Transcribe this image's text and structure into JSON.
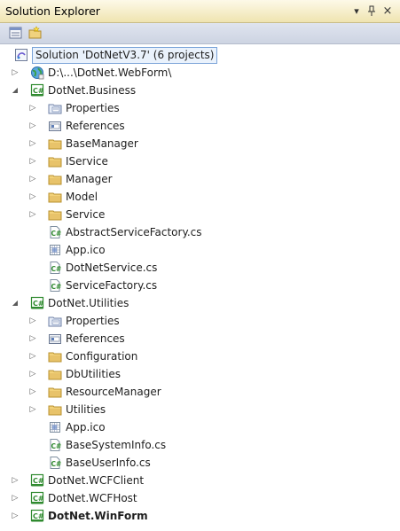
{
  "window": {
    "title": "Solution Explorer",
    "buttons": {
      "dropdown_glyph": "▾",
      "pin_glyph": "ᐩ",
      "close_glyph": "×"
    }
  },
  "toolbar": {
    "items": [
      {
        "name": "properties-icon"
      },
      {
        "name": "show-all-files-icon"
      }
    ]
  },
  "tree": {
    "rows": [
      {
        "id": "solution",
        "depth": 0,
        "expander": "",
        "icon": "solution-icon",
        "label": "Solution 'DotNetV3.7' (6 projects)",
        "selected": true,
        "bold": false
      },
      {
        "id": "webform-site",
        "depth": 1,
        "expander": "collapsed",
        "icon": "website-icon",
        "label": "D:\\...\\DotNet.WebForm\\",
        "bold": false
      },
      {
        "id": "business",
        "depth": 1,
        "expander": "expanded",
        "icon": "csharp-project-icon",
        "label": "DotNet.Business",
        "bold": false
      },
      {
        "id": "b-properties",
        "depth": 2,
        "expander": "collapsed",
        "icon": "properties-folder-icon",
        "label": "Properties",
        "bold": false
      },
      {
        "id": "b-references",
        "depth": 2,
        "expander": "collapsed",
        "icon": "references-icon",
        "label": "References",
        "bold": false
      },
      {
        "id": "b-basemanager",
        "depth": 2,
        "expander": "collapsed",
        "icon": "folder-icon",
        "label": "BaseManager",
        "bold": false
      },
      {
        "id": "b-iservice",
        "depth": 2,
        "expander": "collapsed",
        "icon": "folder-icon",
        "label": "IService",
        "bold": false
      },
      {
        "id": "b-manager",
        "depth": 2,
        "expander": "collapsed",
        "icon": "folder-icon",
        "label": "Manager",
        "bold": false
      },
      {
        "id": "b-model",
        "depth": 2,
        "expander": "collapsed",
        "icon": "folder-icon",
        "label": "Model",
        "bold": false
      },
      {
        "id": "b-service",
        "depth": 2,
        "expander": "collapsed",
        "icon": "folder-icon",
        "label": "Service",
        "bold": false
      },
      {
        "id": "b-asf",
        "depth": 2,
        "expander": "",
        "icon": "csharp-file-icon",
        "label": "AbstractServiceFactory.cs",
        "bold": false
      },
      {
        "id": "b-appico",
        "depth": 2,
        "expander": "",
        "icon": "ico-file-icon",
        "label": "App.ico",
        "bold": false
      },
      {
        "id": "b-dotnetservice",
        "depth": 2,
        "expander": "",
        "icon": "csharp-file-icon",
        "label": "DotNetService.cs",
        "bold": false
      },
      {
        "id": "b-servicefactory",
        "depth": 2,
        "expander": "",
        "icon": "csharp-file-icon",
        "label": "ServiceFactory.cs",
        "bold": false
      },
      {
        "id": "utilities",
        "depth": 1,
        "expander": "expanded",
        "icon": "csharp-project-icon",
        "label": "DotNet.Utilities",
        "bold": false
      },
      {
        "id": "u-properties",
        "depth": 2,
        "expander": "collapsed",
        "icon": "properties-folder-icon",
        "label": "Properties",
        "bold": false
      },
      {
        "id": "u-references",
        "depth": 2,
        "expander": "collapsed",
        "icon": "references-icon",
        "label": "References",
        "bold": false
      },
      {
        "id": "u-configuration",
        "depth": 2,
        "expander": "collapsed",
        "icon": "folder-icon",
        "label": "Configuration",
        "bold": false
      },
      {
        "id": "u-dbutilities",
        "depth": 2,
        "expander": "collapsed",
        "icon": "folder-icon",
        "label": "DbUtilities",
        "bold": false
      },
      {
        "id": "u-resourcemanager",
        "depth": 2,
        "expander": "collapsed",
        "icon": "folder-icon",
        "label": "ResourceManager",
        "bold": false
      },
      {
        "id": "u-utilities",
        "depth": 2,
        "expander": "collapsed",
        "icon": "folder-icon",
        "label": "Utilities",
        "bold": false
      },
      {
        "id": "u-appico",
        "depth": 2,
        "expander": "",
        "icon": "ico-file-icon",
        "label": "App.ico",
        "bold": false
      },
      {
        "id": "u-basesysteminfo",
        "depth": 2,
        "expander": "",
        "icon": "csharp-file-icon",
        "label": "BaseSystemInfo.cs",
        "bold": false
      },
      {
        "id": "u-baseuserinfo",
        "depth": 2,
        "expander": "",
        "icon": "csharp-file-icon",
        "label": "BaseUserInfo.cs",
        "bold": false
      },
      {
        "id": "wcfclient",
        "depth": 1,
        "expander": "collapsed",
        "icon": "csharp-project-icon",
        "label": "DotNet.WCFClient",
        "bold": false
      },
      {
        "id": "wcfhost",
        "depth": 1,
        "expander": "collapsed",
        "icon": "csharp-project-icon",
        "label": "DotNet.WCFHost",
        "bold": false
      },
      {
        "id": "winform",
        "depth": 1,
        "expander": "collapsed",
        "icon": "csharp-project-icon",
        "label": "DotNet.WinForm",
        "bold": true
      }
    ]
  },
  "colors": {
    "titlebar_top": "#fdf9e8",
    "titlebar_bottom": "#efe4b0",
    "selection_border": "#7aa3d8",
    "selection_fill": "#eaf2fc",
    "folder": "#e8c36a",
    "csharp_green": "#2f8a2f"
  }
}
